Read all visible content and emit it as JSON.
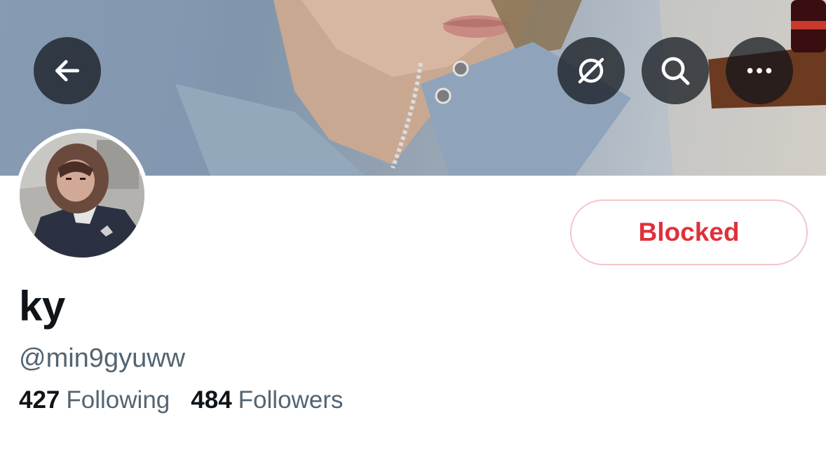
{
  "header": {
    "back_icon": "arrow-left-icon",
    "translate_icon": "translate-disabled-icon",
    "search_icon": "search-icon",
    "more_icon": "more-dots-icon"
  },
  "profile": {
    "display_name": "ky",
    "handle": "@min9gyuww",
    "block_button_label": "Blocked",
    "following_count": "427",
    "following_label": "Following",
    "followers_count": "484",
    "followers_label": "Followers"
  },
  "colors": {
    "blocked_red": "#e0303a",
    "blocked_border": "#f4c6c9",
    "text_primary": "#0f1419",
    "text_secondary": "#536471",
    "header_button_bg": "rgba(15,20,25,0.72)"
  }
}
